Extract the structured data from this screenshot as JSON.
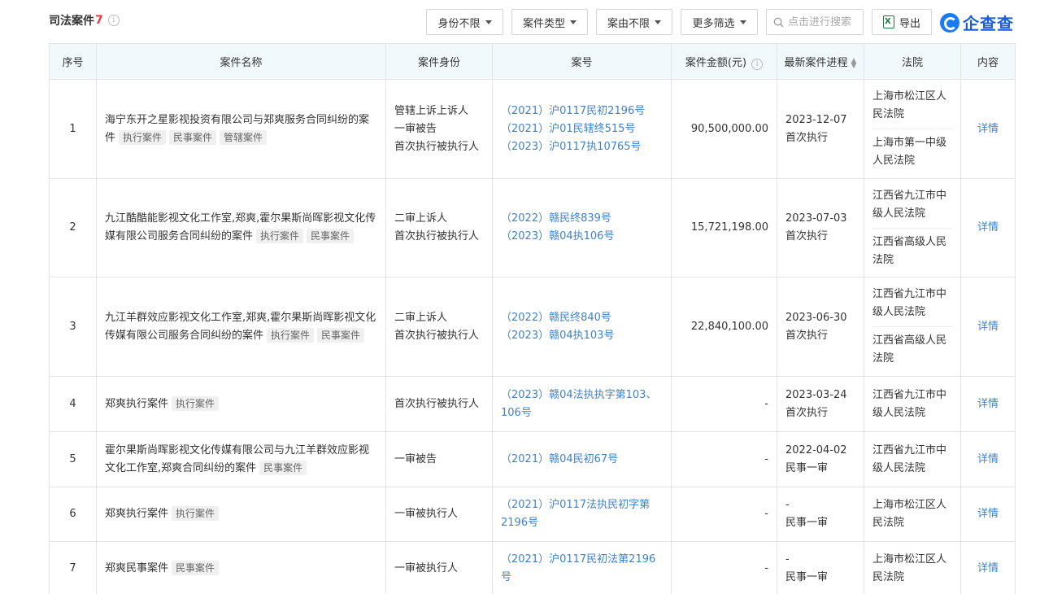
{
  "header": {
    "title": "司法案件",
    "count": "7",
    "filters": [
      {
        "label": "身份不限"
      },
      {
        "label": "案件类型"
      },
      {
        "label": "案由不限"
      },
      {
        "label": "更多筛选"
      }
    ],
    "search_placeholder": "点击进行搜索",
    "export_label": "导出",
    "logo_text": "企查查"
  },
  "table": {
    "columns": [
      "序号",
      "案件名称",
      "案件身份",
      "案号",
      "案件金额(元)",
      "最新案件进程",
      "法院",
      "内容"
    ],
    "rows": [
      {
        "no": "1",
        "name": "海宁东开之星影视投资有限公司与郑爽服务合同纠纷的案件",
        "tags": [
          "执行案件",
          "民事案件",
          "管辖案件"
        ],
        "roles": [
          "管辖上诉上诉人",
          "一审被告",
          "首次执行被执行人"
        ],
        "case_nos": [
          "（2021）沪0117民初2196号",
          "（2021）沪01民辖终515号",
          "（2023）沪0117执10765号"
        ],
        "amount": "90,500,000.00",
        "date": "2023-12-07",
        "stage": "首次执行",
        "courts": [
          "上海市松江区人民法院",
          "上海市第一中级人民法院"
        ],
        "detail": "详情"
      },
      {
        "no": "2",
        "name": "九江酷酷能影视文化工作室,郑爽,霍尔果斯尚晖影视文化传媒有限公司服务合同纠纷的案件",
        "tags": [
          "执行案件",
          "民事案件"
        ],
        "roles": [
          "二审上诉人",
          "首次执行被执行人"
        ],
        "case_nos": [
          "（2022）赣民终839号",
          "（2023）赣04执106号"
        ],
        "amount": "15,721,198.00",
        "date": "2023-07-03",
        "stage": "首次执行",
        "courts": [
          "江西省九江市中级人民法院",
          "江西省高级人民法院"
        ],
        "detail": "详情"
      },
      {
        "no": "3",
        "name": "九江羊群效应影视文化工作室,郑爽,霍尔果斯尚晖影视文化传媒有限公司服务合同纠纷的案件",
        "tags": [
          "执行案件",
          "民事案件"
        ],
        "roles": [
          "二审上诉人",
          "首次执行被执行人"
        ],
        "case_nos": [
          "（2022）赣民终840号",
          "（2023）赣04执103号"
        ],
        "amount": "22,840,100.00",
        "date": "2023-06-30",
        "stage": "首次执行",
        "courts": [
          "江西省九江市中级人民法院",
          "江西省高级人民法院"
        ],
        "detail": "详情"
      },
      {
        "no": "4",
        "name": "郑爽执行案件",
        "tags": [
          "执行案件"
        ],
        "roles": [
          "首次执行被执行人"
        ],
        "case_nos": [
          "（2023）赣04法执执字第103、106号"
        ],
        "amount": "-",
        "date": "2023-03-24",
        "stage": "首次执行",
        "courts": [
          "江西省九江市中级人民法院"
        ],
        "detail": "详情"
      },
      {
        "no": "5",
        "name": "霍尔果斯尚晖影视文化传媒有限公司与九江羊群效应影视文化工作室,郑爽合同纠纷的案件",
        "tags": [
          "民事案件"
        ],
        "roles": [
          "一审被告"
        ],
        "case_nos": [
          "（2021）赣04民初67号"
        ],
        "amount": "-",
        "date": "2022-04-02",
        "stage": "民事一审",
        "courts": [
          "江西省九江市中级人民法院"
        ],
        "detail": "详情"
      },
      {
        "no": "6",
        "name": "郑爽执行案件",
        "tags": [
          "执行案件"
        ],
        "roles": [
          "一审被执行人"
        ],
        "case_nos": [
          "（2021）沪0117法执民初字第2196号"
        ],
        "amount": "-",
        "date": "-",
        "stage": "民事一审",
        "courts": [
          "上海市松江区人民法院"
        ],
        "detail": "详情"
      },
      {
        "no": "7",
        "name": "郑爽民事案件",
        "tags": [
          "民事案件"
        ],
        "roles": [
          "一审被执行人"
        ],
        "case_nos": [
          "（2021）沪0117民初法第2196号"
        ],
        "amount": "-",
        "date": "-",
        "stage": "民事一审",
        "courts": [
          "上海市松江区人民法院"
        ],
        "detail": "详情"
      }
    ]
  }
}
